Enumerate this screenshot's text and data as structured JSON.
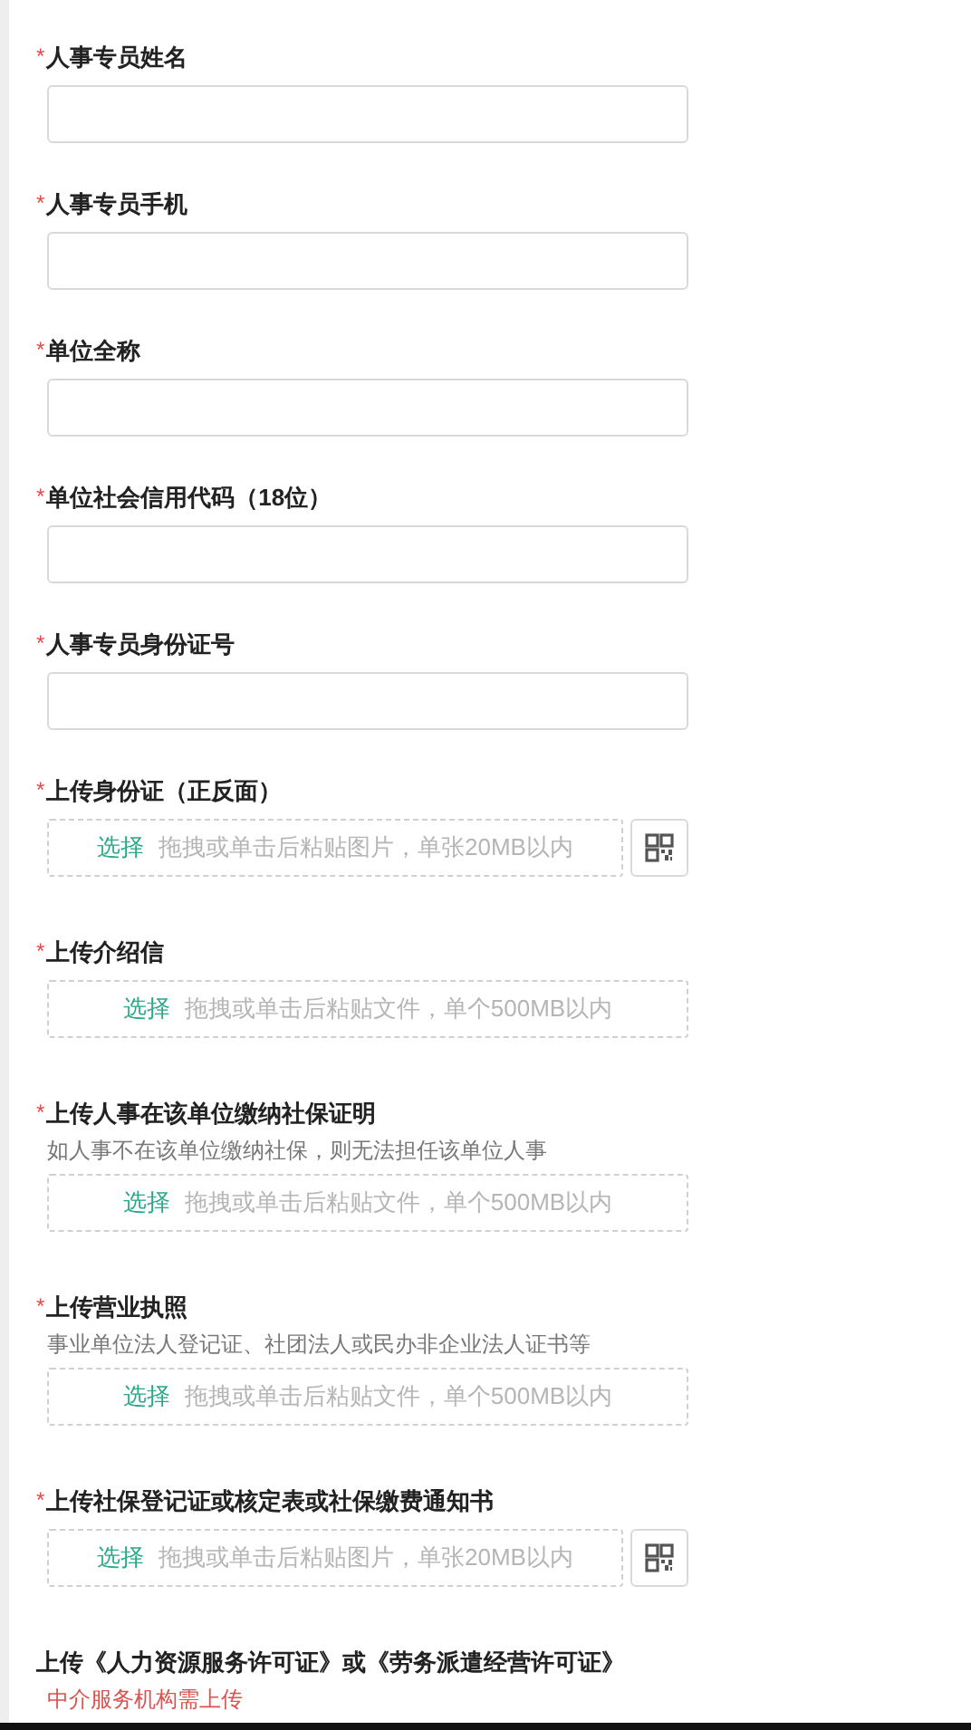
{
  "fields": [
    {
      "kind": "text",
      "required_mark": "*",
      "label": "人事专员姓名"
    },
    {
      "kind": "text",
      "required_mark": "*",
      "label": "人事专员手机"
    },
    {
      "kind": "text",
      "required_mark": "*",
      "label": "单位全称"
    },
    {
      "kind": "text",
      "required_mark": "*",
      "label": "单位社会信用代码（18位）"
    },
    {
      "kind": "text",
      "required_mark": "*",
      "label": "人事专员身份证号"
    },
    {
      "kind": "image_upload",
      "required_mark": "*",
      "label": "上传身份证（正反面）",
      "button": "选择",
      "placeholder": "拖拽或单击后粘贴图片，单张20MB以内"
    },
    {
      "kind": "file_upload",
      "required_mark": "*",
      "label": "上传介绍信",
      "button": "选择",
      "placeholder": "拖拽或单击后粘贴文件，单个500MB以内"
    },
    {
      "kind": "file_upload",
      "required_mark": "*",
      "label": "上传人事在该单位缴纳社保证明",
      "hint": "如人事不在该单位缴纳社保，则无法担任该单位人事",
      "button": "选择",
      "placeholder": "拖拽或单击后粘贴文件，单个500MB以内"
    },
    {
      "kind": "file_upload",
      "required_mark": "*",
      "label": "上传营业执照",
      "hint": "事业单位法人登记证、社团法人或民办非企业法人证书等",
      "button": "选择",
      "placeholder": "拖拽或单击后粘贴文件，单个500MB以内"
    },
    {
      "kind": "image_upload",
      "required_mark": "*",
      "label": "上传社保登记证或核定表或社保缴费通知书",
      "button": "选择",
      "placeholder": "拖拽或单击后粘贴图片，单张20MB以内"
    },
    {
      "kind": "heading",
      "label": "上传《人力资源服务许可证》或《劳务派遣经营许可证》",
      "notice": "中介服务机构需上传"
    }
  ]
}
